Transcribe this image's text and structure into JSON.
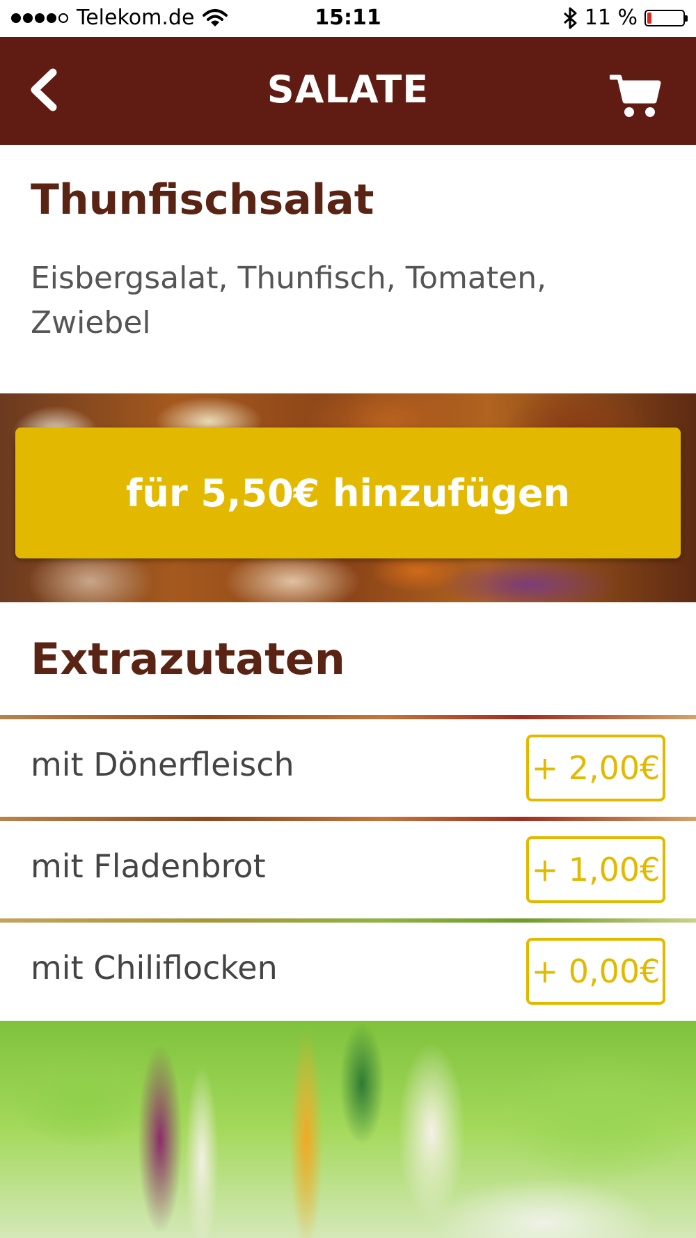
{
  "status_bar": {
    "carrier": "Telekom.de",
    "time": "15:11",
    "battery_percent": "11 %",
    "battery_level": 0.11,
    "signal_strength": 4,
    "signal_max": 5
  },
  "nav": {
    "title": "SALATE",
    "back_icon": "chevron-left-icon",
    "cart_icon": "cart-icon"
  },
  "product": {
    "title": "Thunfischsalat",
    "description": "Eisbergsalat, Thunfisch, Tomaten, Zwiebel"
  },
  "add_button": {
    "label": "für 5,50€ hinzufügen"
  },
  "extras": {
    "title": "Extrazutaten",
    "items": [
      {
        "label": "mit Dönerfleisch",
        "price": "+ 2,00€"
      },
      {
        "label": "mit Fladenbrot",
        "price": "+ 1,00€"
      },
      {
        "label": "mit Chiliflocken",
        "price": "+ 0,00€"
      }
    ]
  },
  "colors": {
    "nav_background": "#601c12",
    "accent_yellow": "#e3b900",
    "heading_brown": "#5a2415",
    "text_gray": "#555555"
  }
}
